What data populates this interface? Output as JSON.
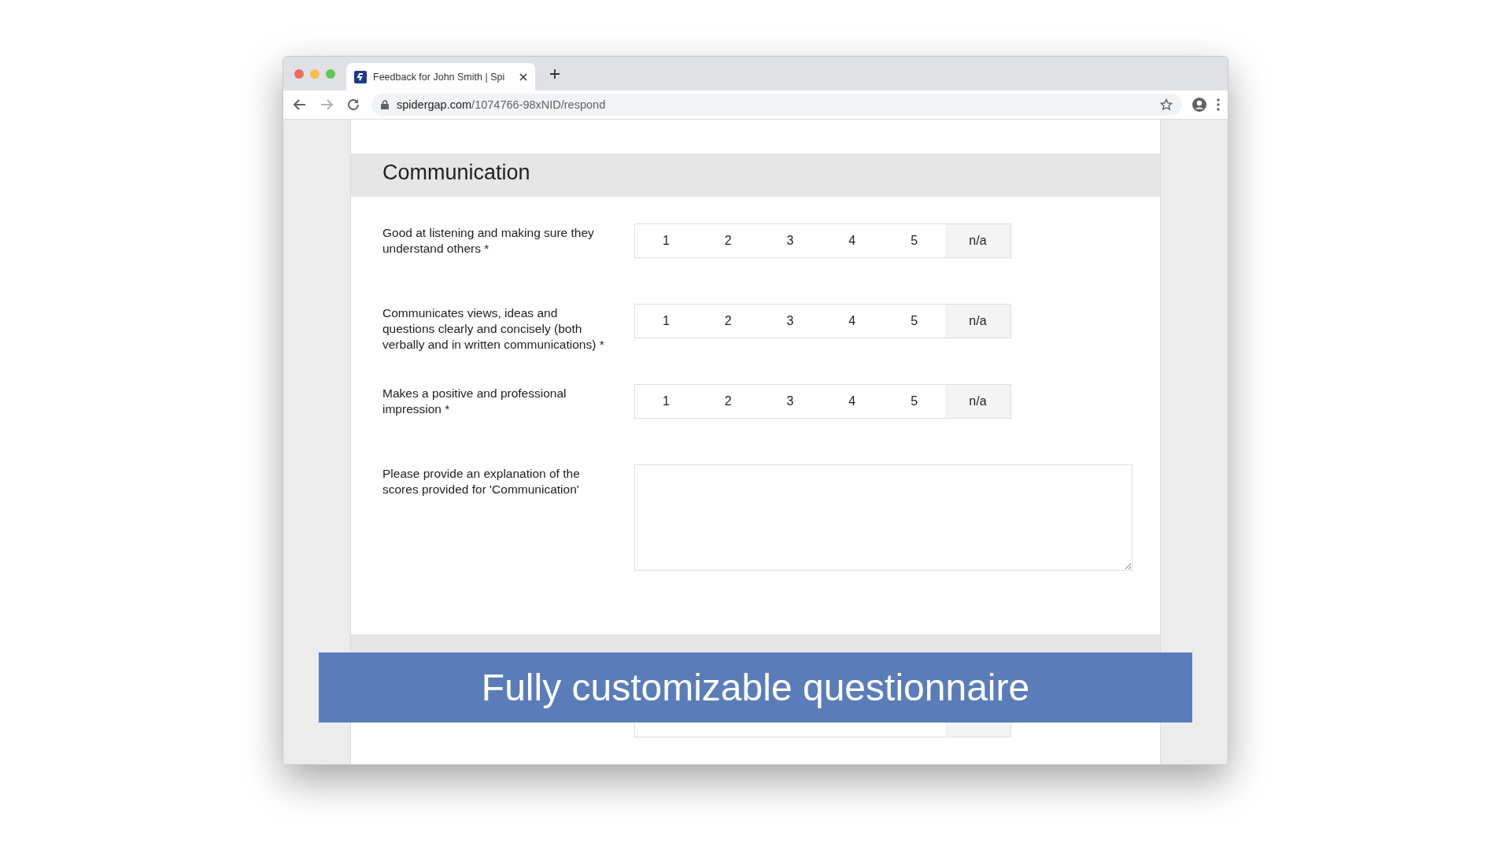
{
  "browser": {
    "tab": {
      "title": "Feedback for John Smith | Spi"
    },
    "address": {
      "host": "spidergap.com",
      "path": "/1074766-98xNID/respond"
    }
  },
  "sections": [
    {
      "title": "Communication",
      "questions": [
        {
          "kind": "rating",
          "label": "Good at listening and making sure they understand others *",
          "scale": [
            "1",
            "2",
            "3",
            "4",
            "5"
          ],
          "na": "n/a"
        },
        {
          "kind": "rating",
          "label": "Communicates views, ideas and questions clearly and concisely (both verbally and in written communications) *",
          "scale": [
            "1",
            "2",
            "3",
            "4",
            "5"
          ],
          "na": "n/a"
        },
        {
          "kind": "rating",
          "label": "Makes a positive and professional impression *",
          "scale": [
            "1",
            "2",
            "3",
            "4",
            "5"
          ],
          "na": "n/a"
        },
        {
          "kind": "text",
          "label": "Please provide an explanation of the scores provided for 'Communication'"
        }
      ]
    }
  ],
  "banner": "Fully customizable questionnaire"
}
